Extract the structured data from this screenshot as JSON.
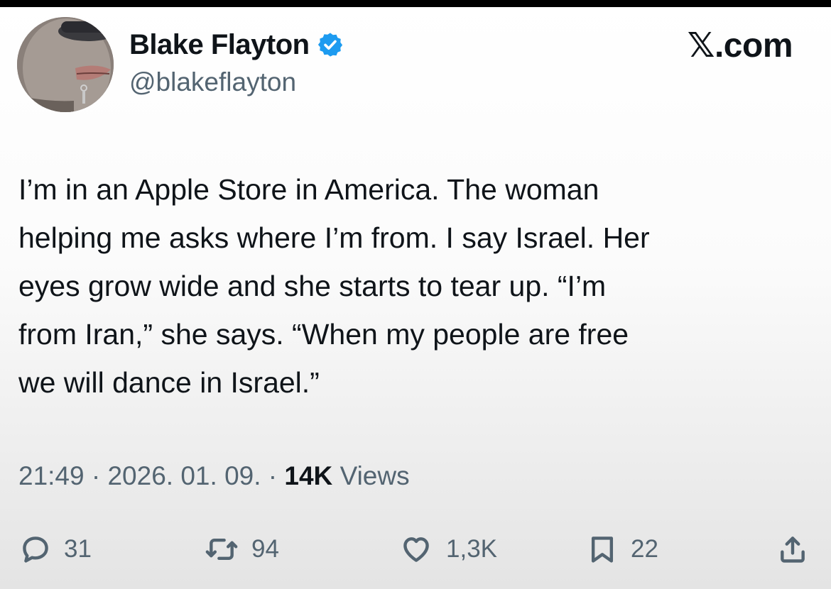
{
  "author": {
    "display_name": "Blake Flayton",
    "handle": "@blakeflayton",
    "verified_icon": "verified-badge-icon",
    "verified_color": "#1d9bf0"
  },
  "source_label": "𝕏.com",
  "tweet": {
    "lines": [
      "I’m in an Apple Store in America. The woman",
      "helping me asks where I’m from. I say Israel. Her",
      "eyes grow wide and she starts to tear up. “I’m",
      "from Iran,” she says. “When my people are free",
      "we will dance in Israel.”"
    ]
  },
  "meta": {
    "time": "21:49",
    "separator": " · ",
    "date": "2026. 01. 09.",
    "views_count": "14K",
    "views_label": " Views"
  },
  "actions": {
    "replies": {
      "icon": "reply-icon",
      "count": "31"
    },
    "reposts": {
      "icon": "repost-icon",
      "count": "94"
    },
    "likes": {
      "icon": "heart-icon",
      "count": "1,3K"
    },
    "bookmarks": {
      "icon": "bookmark-icon",
      "count": "22"
    },
    "share": {
      "icon": "share-icon"
    }
  },
  "colors": {
    "text_primary": "#0f1419",
    "text_secondary": "#536471",
    "top_bar": "#000000"
  }
}
